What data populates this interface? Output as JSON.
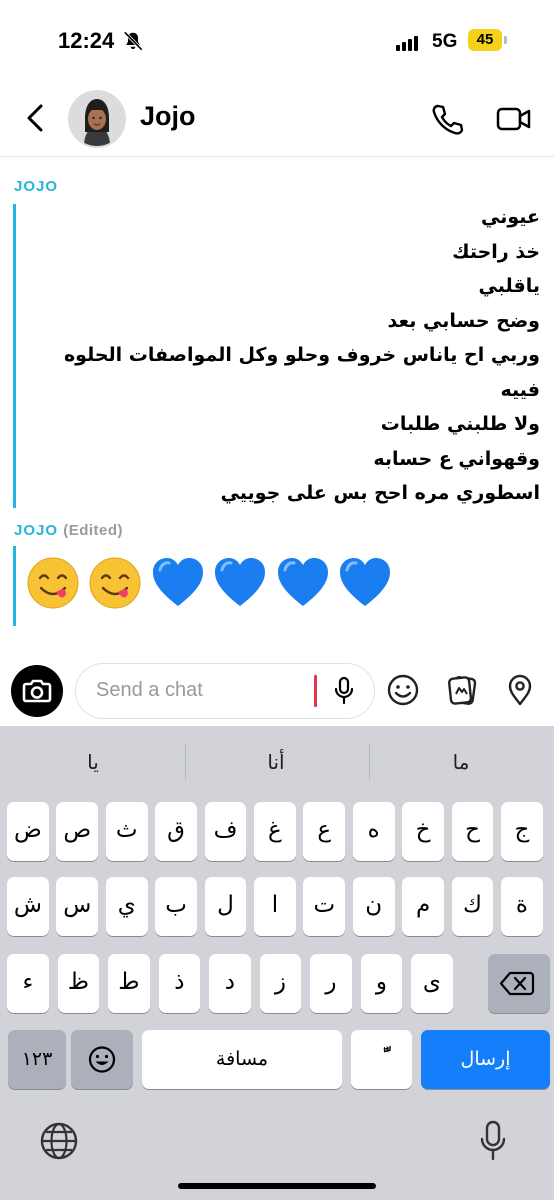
{
  "status_bar": {
    "time": "12:24",
    "network": "5G",
    "battery": "45"
  },
  "header": {
    "contact_name": "Jojo"
  },
  "chat": {
    "messages": [
      {
        "sender": "JOJO",
        "edited": "",
        "lines": [
          "عيوني",
          "خذ راحتك",
          "ياقلبي",
          "وضح حسابي بعد",
          "وربي اح ياناس خروف وحلو وكل المواصفات الحلوه",
          "فييه",
          "ولا طلبني طلبات",
          "وقهواني ع حسابه",
          "اسطوري مره احح بس على جوييي"
        ]
      },
      {
        "sender": "JOJO",
        "edited": "(Edited)",
        "emojis": [
          "face-savoring-food",
          "face-savoring-food",
          "blue-heart",
          "blue-heart",
          "blue-heart",
          "blue-heart"
        ]
      }
    ]
  },
  "composer": {
    "placeholder": "Send a chat"
  },
  "keyboard": {
    "suggestions": [
      "يا",
      "أنا",
      "ما"
    ],
    "row1": [
      "ض",
      "ص",
      "ث",
      "ق",
      "ف",
      "غ",
      "ع",
      "ه",
      "خ",
      "ح",
      "ج"
    ],
    "row2": [
      "ش",
      "س",
      "ي",
      "ب",
      "ل",
      "ا",
      "ت",
      "ن",
      "م",
      "ك",
      "ة"
    ],
    "row3": [
      "ء",
      "ظ",
      "ط",
      "ذ",
      "د",
      "ز",
      "ر",
      "و",
      "ى"
    ],
    "numbers_label": "١٢٣",
    "space_label": "مسافة",
    "diacritic_label": "ًّ",
    "send_label": "إرسال"
  },
  "colors": {
    "accent": "#23b5e0",
    "send_key": "#147efb",
    "battery": "#f5d21a"
  }
}
